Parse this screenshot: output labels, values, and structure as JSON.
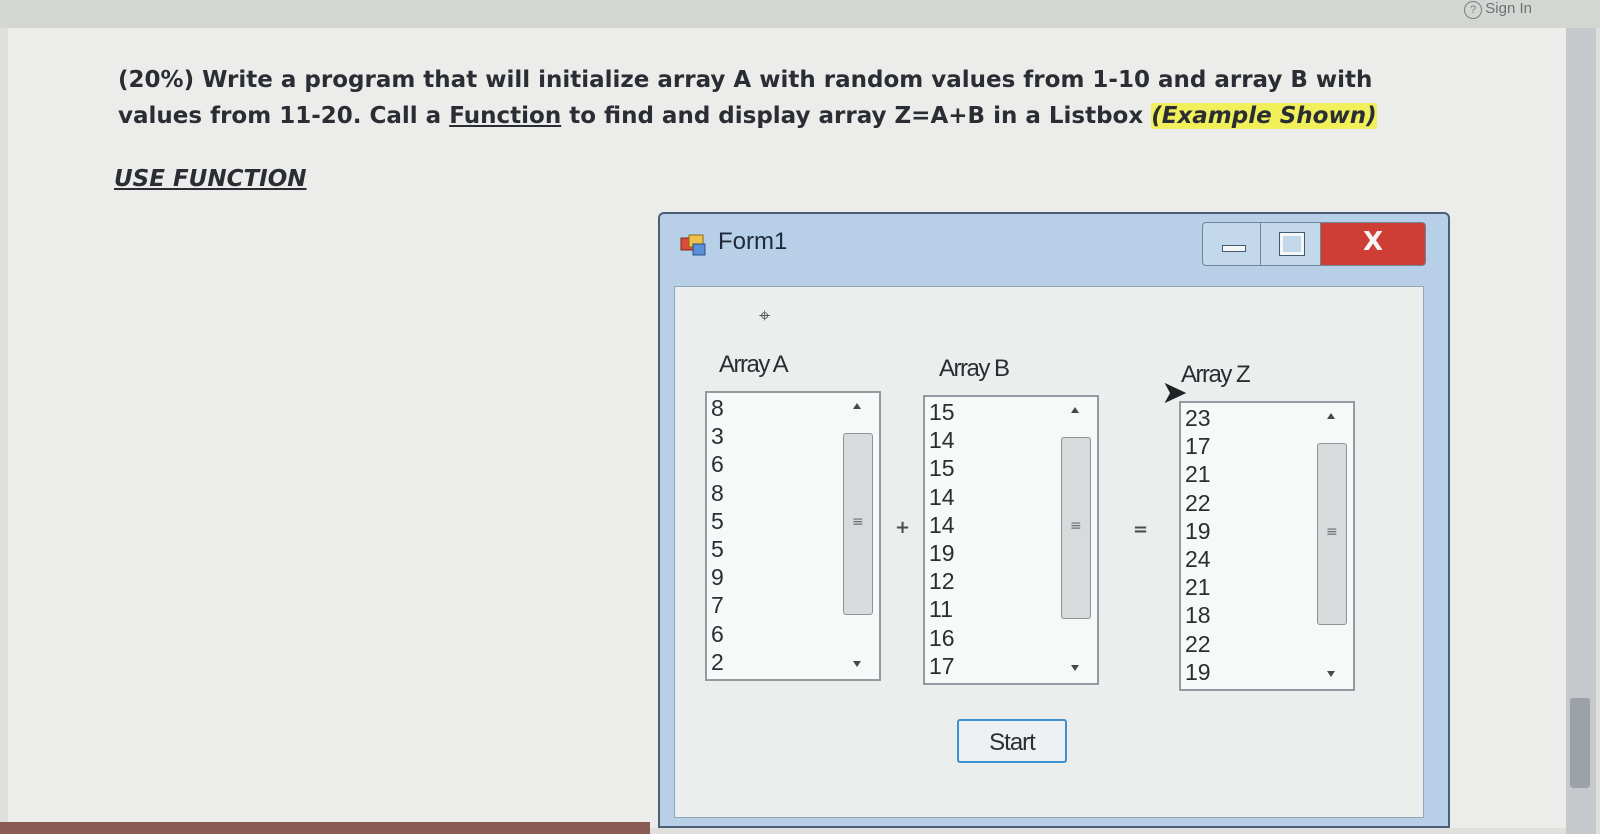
{
  "browser": {
    "sign_in": "Sign In"
  },
  "question": {
    "text_part1": "(20%) Write a program that will initialize array A with random values from 1-10 and array B with values from 11-20. Call a ",
    "link_word": "Function",
    "text_part2": " to find and display array Z=A+B in a Listbox ",
    "highlight": "(Example Shown)",
    "instruction": "USE FUNCTION"
  },
  "form": {
    "title": "Form1",
    "close_glyph": "X",
    "array_a": {
      "label": "Array A",
      "items": [
        "8",
        "3",
        "6",
        "8",
        "5",
        "5",
        "9",
        "7",
        "6",
        "2"
      ]
    },
    "array_b": {
      "label": "Array B",
      "items": [
        "15",
        "14",
        "15",
        "14",
        "14",
        "19",
        "12",
        "11",
        "16",
        "17"
      ]
    },
    "array_z": {
      "label": "Array Z",
      "items": [
        "23",
        "17",
        "21",
        "22",
        "19",
        "24",
        "21",
        "18",
        "22",
        "19"
      ]
    },
    "plus_sign": "+",
    "equals_sign": "=",
    "start_button": "Start"
  },
  "colors": {
    "highlight": "#f1f05a",
    "close_button": "#cf3e35",
    "start_border": "#3d8fd0"
  }
}
